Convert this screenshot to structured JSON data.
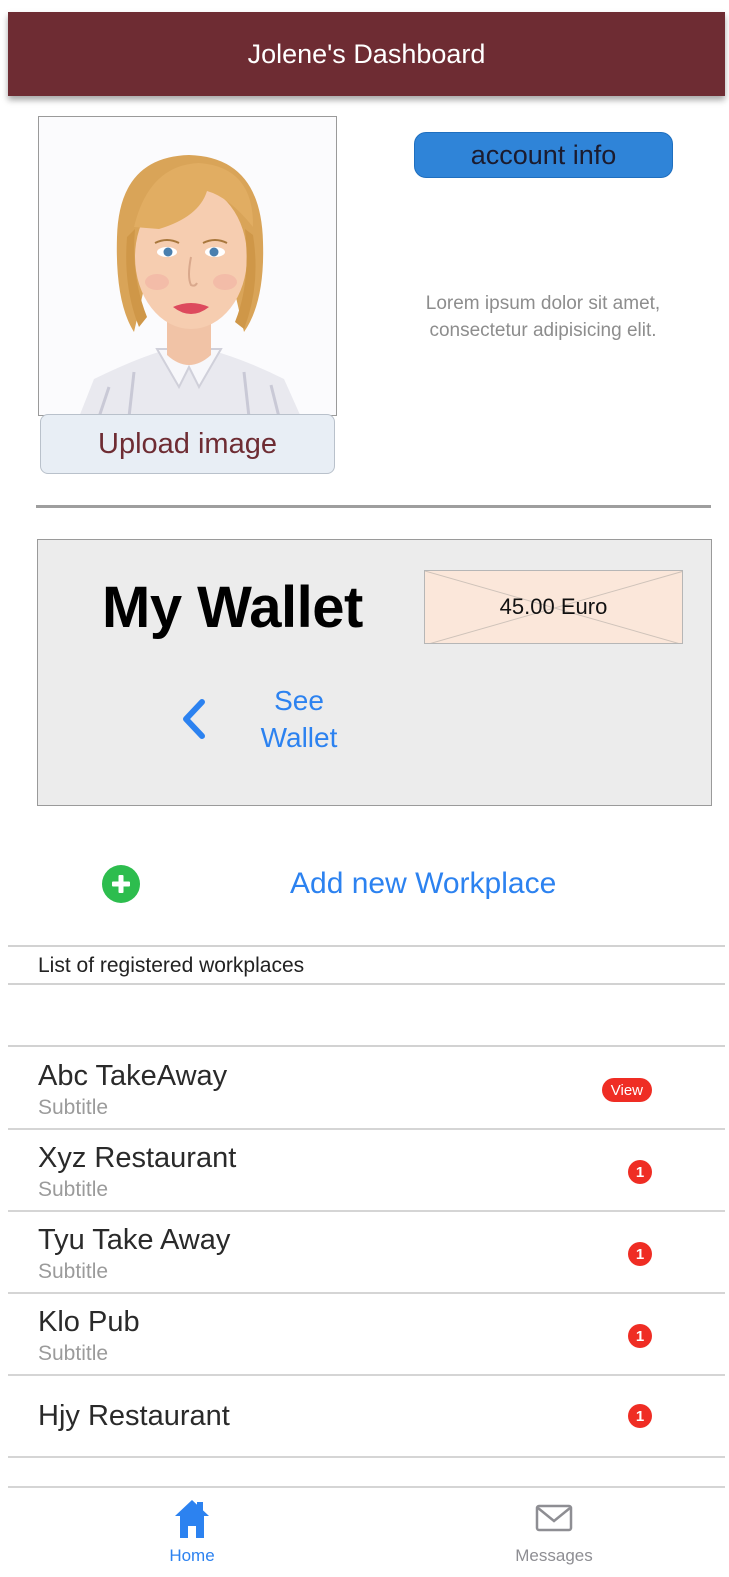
{
  "header": {
    "title": "Jolene's Dashboard"
  },
  "profile": {
    "upload_label": "Upload image",
    "account_label": "account info",
    "description": "Lorem ipsum dolor sit amet, consectetur adipisicing elit."
  },
  "wallet": {
    "title": "My Wallet",
    "amount": "45.00 Euro",
    "see_label": "See Wallet"
  },
  "workplaces": {
    "add_label": "Add new Workplace",
    "list_caption": "List of registered workplaces",
    "items": [
      {
        "name": "Abc TakeAway",
        "subtitle": "Subtitle",
        "badge": "View"
      },
      {
        "name": "Xyz Restaurant",
        "subtitle": "Subtitle",
        "badge": "1"
      },
      {
        "name": "Tyu Take Away",
        "subtitle": "Subtitle",
        "badge": "1"
      },
      {
        "name": "Klo Pub",
        "subtitle": "Subtitle",
        "badge": "1"
      },
      {
        "name": "Hjy Restaurant",
        "subtitle": "",
        "badge": "1"
      }
    ]
  },
  "tabs": {
    "home": {
      "label": "Home",
      "icon": "home-icon"
    },
    "messages": {
      "label": "Messages",
      "icon": "mail-icon"
    }
  },
  "colors": {
    "header": "#6e2c33",
    "accent_blue": "#2c82f0",
    "badge_red": "#ef2d24",
    "add_green": "#2dbd4e",
    "wallet_amount_bg": "#fbe7da"
  }
}
